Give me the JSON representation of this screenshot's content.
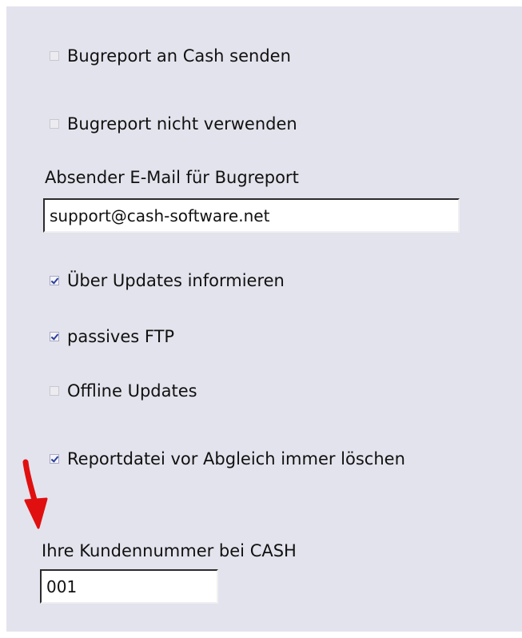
{
  "options": {
    "bugreport_send": {
      "label": "Bugreport an Cash senden",
      "checked": false
    },
    "bugreport_disable": {
      "label": "Bugreport nicht verwenden",
      "checked": false
    },
    "sender_email": {
      "label": "Absender E-Mail für Bugreport",
      "value": "support@cash-software.net"
    },
    "inform_updates": {
      "label": "Über Updates informieren",
      "checked": true
    },
    "passive_ftp": {
      "label": "passives FTP",
      "checked": true
    },
    "offline_updates": {
      "label": "Offline Updates",
      "checked": false
    },
    "delete_report": {
      "label": "Reportdatei vor Abgleich immer löschen",
      "checked": true
    },
    "customer_number": {
      "label": "Ihre Kundennummer bei CASH",
      "value": "001"
    }
  },
  "annotation": {
    "arrow_color": "#e01010"
  }
}
